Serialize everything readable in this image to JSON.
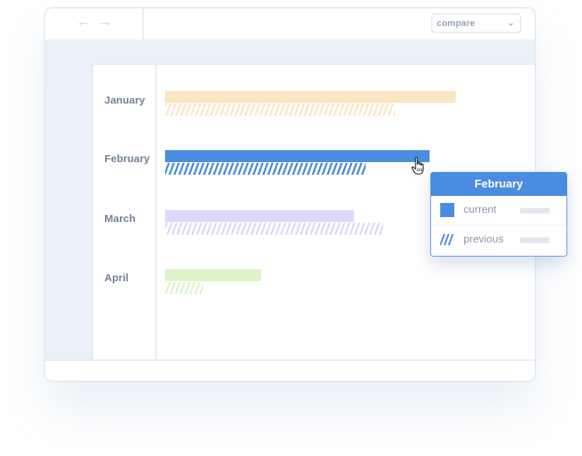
{
  "toolbar": {
    "back_icon": "arrow-left-icon",
    "forward_icon": "arrow-right-icon",
    "back_glyph": "←",
    "forward_glyph": "→",
    "compare_select": {
      "value": "compare",
      "icon": "chevron-down-icon",
      "chevron_glyph": "⌄"
    }
  },
  "chart_data": {
    "type": "bar",
    "orientation": "horizontal",
    "categories": [
      "January",
      "February",
      "March",
      "April"
    ],
    "series": [
      {
        "name": "current",
        "values": [
          100,
          91,
          65,
          33
        ],
        "style": "solid"
      },
      {
        "name": "previous",
        "values": [
          79,
          69,
          75,
          13
        ],
        "style": "hatched"
      }
    ],
    "xlim": [
      0,
      100
    ],
    "category_colors": {
      "January": "#fbe6c2",
      "February": "#4a8de0",
      "March": "#ddd9fb",
      "April": "#def4c8"
    },
    "grid": false,
    "legend": "tooltip"
  },
  "tooltip": {
    "title": "February",
    "rows": [
      {
        "label": "current",
        "swatch": "solid",
        "color": "#4a8de0"
      },
      {
        "label": "previous",
        "swatch": "hatched",
        "color": "#4a8de0"
      }
    ]
  },
  "cursor_icon": "pointer-hand-icon"
}
